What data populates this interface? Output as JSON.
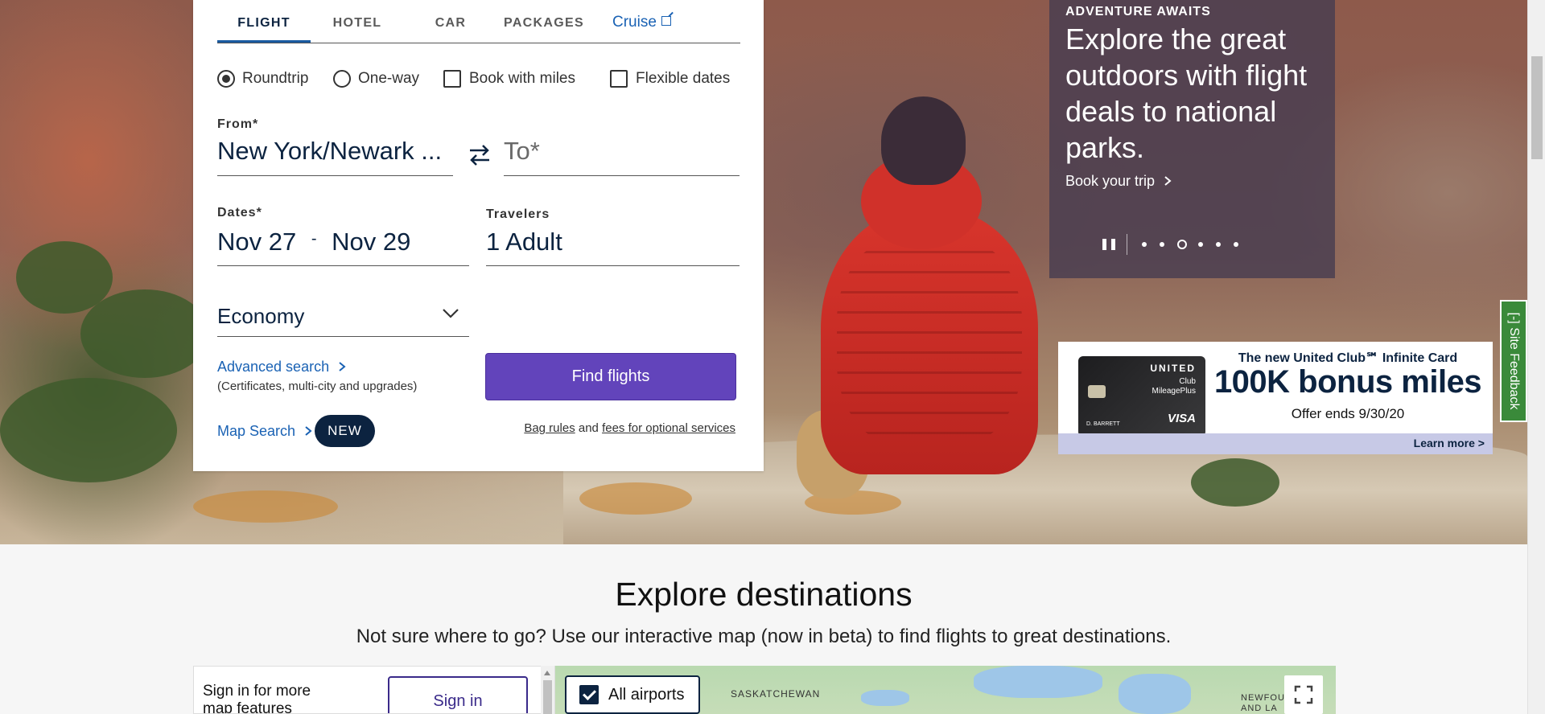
{
  "booking": {
    "tabs": [
      {
        "label": "FLIGHT"
      },
      {
        "label": "HOTEL"
      },
      {
        "label": "CAR"
      },
      {
        "label": "PACKAGES"
      },
      {
        "label": "Cruise"
      }
    ],
    "trip_options": {
      "roundtrip": "Roundtrip",
      "oneway": "One-way",
      "miles": "Book with miles",
      "flexible": "Flexible dates"
    },
    "from_label": "From*",
    "from_value": "New York/Newark ...",
    "to_placeholder": "To*",
    "dates_label": "Dates*",
    "depart_date": "Nov 27",
    "date_separator": "-",
    "return_date": "Nov 29",
    "travelers_label": "Travelers",
    "travelers_value": "1 Adult",
    "cabin_value": "Economy",
    "advanced_search": "Advanced search",
    "advanced_note": "(Certificates, multi-city and upgrades)",
    "map_search": "Map Search",
    "new_badge": "NEW",
    "find_flights": "Find flights",
    "bag_rules": "Bag rules",
    "and_text": "and",
    "fees_link": "fees for optional services"
  },
  "promo": {
    "kicker": "ADVENTURE AWAITS",
    "title": "Explore the great outdoors with flight deals to national parks.",
    "link": "Book your trip",
    "carousel_active_index": 3,
    "carousel_count": 6
  },
  "ad": {
    "card_brand": "UNITED",
    "card_club": "Club",
    "card_program": "MileagePlus",
    "card_holder": "D. BARRETT",
    "card_network": "VISA",
    "line1": "The new United Club℠ Infinite Card",
    "line2": "100K bonus miles",
    "line3": "Offer ends 9/30/20",
    "cta": "Learn more >"
  },
  "feedback": {
    "label": "[-] Site Feedback"
  },
  "explore": {
    "title": "Explore destinations",
    "subtitle": "Not sure where to go? Use our interactive map (now in beta) to find flights to great destinations.",
    "signin_text": "Sign in for more map features",
    "signin_button": "Sign in",
    "airports_toggle": "All airports",
    "map_labels": {
      "saskatchewan": "SASKATCHEWAN",
      "newfoundland": "NEWFOU AND LA"
    }
  },
  "colors": {
    "brand_navy": "#0c2340",
    "button_purple": "#6244bb",
    "link_blue": "#1a62b4",
    "feedback_green": "#3a8a3a"
  }
}
